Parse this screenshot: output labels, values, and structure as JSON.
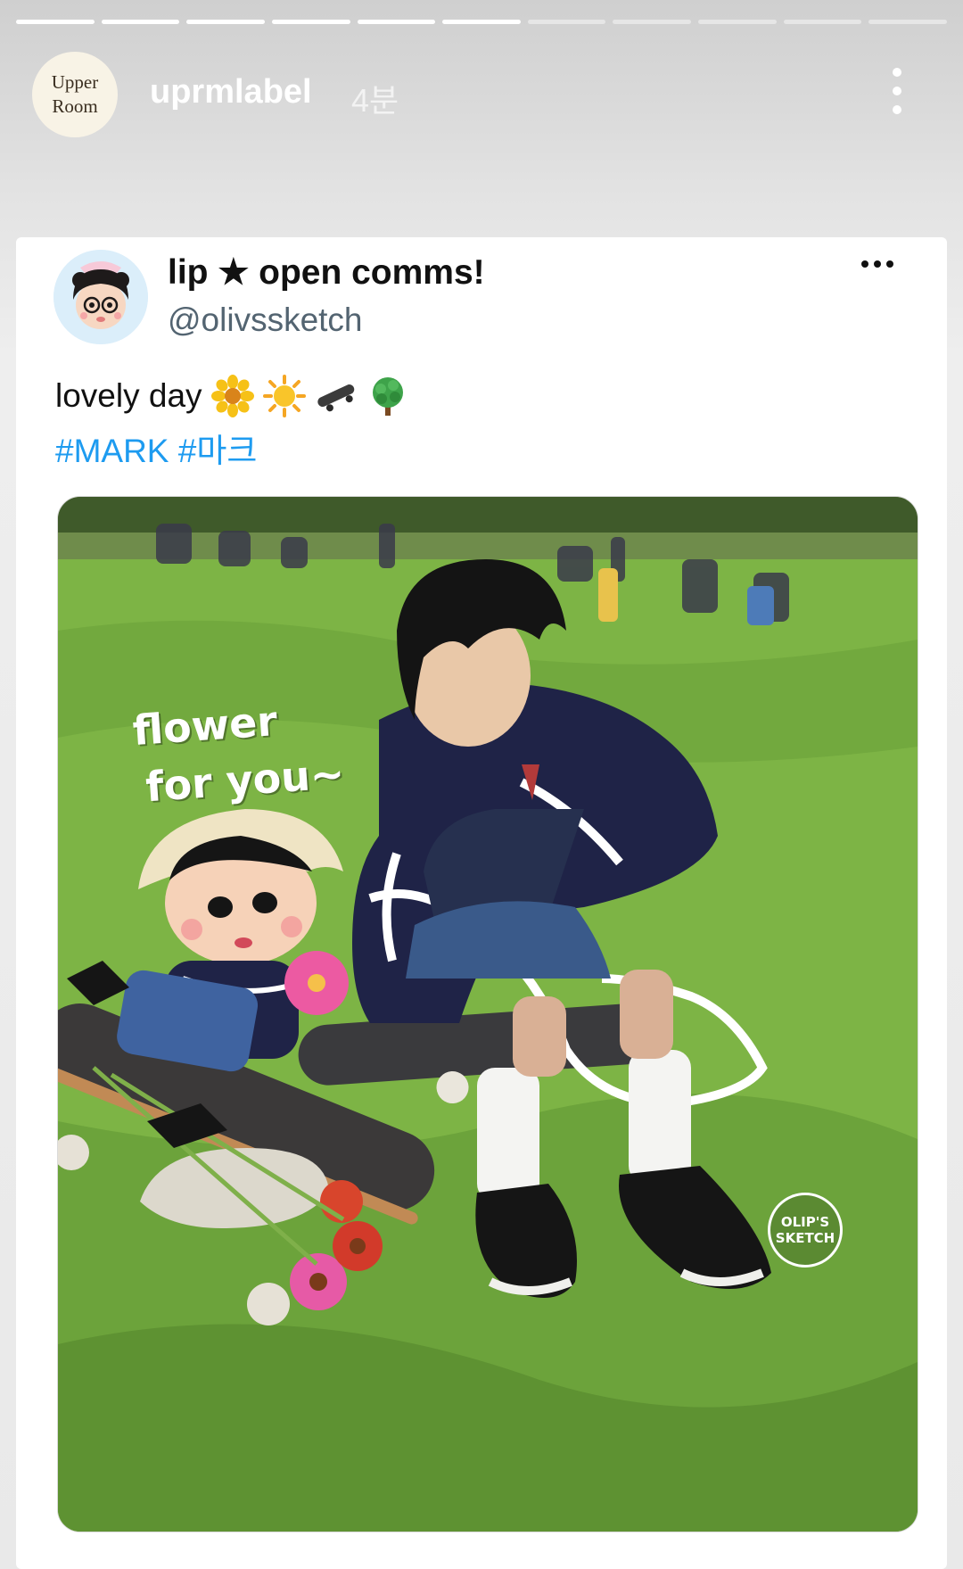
{
  "story": {
    "progress_total": 11,
    "progress_done": 6,
    "avatar_line1": "Upper",
    "avatar_line2": "Room",
    "username": "uprmlabel",
    "time": "4분",
    "menu_icon": "more-vertical-icon"
  },
  "tweet": {
    "display_name": "lip ★ open comms!",
    "handle": "@olivssketch",
    "text": "lovely day",
    "emojis": [
      "sunflower-icon",
      "sun-icon",
      "skateboard-icon",
      "tree-icon"
    ],
    "hashtags": "#MARK #마크",
    "more_icon": "more-horizontal-icon"
  },
  "photo": {
    "overlay_line1": "flower",
    "overlay_line2": "for you~",
    "watermark_line1": "OLIP'S",
    "watermark_line2": "SKETCH"
  }
}
